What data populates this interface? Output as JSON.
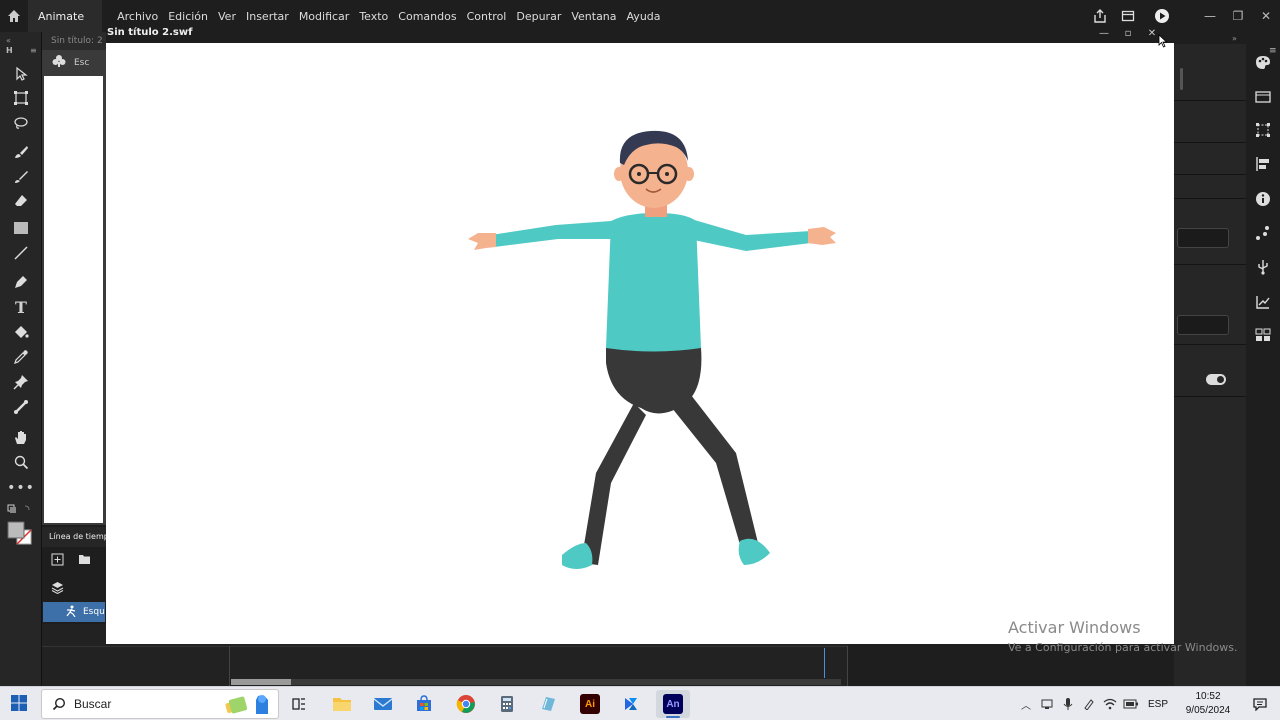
{
  "app": {
    "workspace": "Animate",
    "menu": [
      "Archivo",
      "Edición",
      "Ver",
      "Insertar",
      "Modificar",
      "Texto",
      "Comandos",
      "Control",
      "Depurar",
      "Ventana",
      "Ayuda"
    ]
  },
  "document": {
    "tab_title": "Sin título: 2",
    "scene_label": "Esc",
    "timeline_label": "Línea de tiemp",
    "layer_name": "Esqu"
  },
  "swf_window": {
    "title": "Sin título 2.swf"
  },
  "tools": [
    "selection-tool",
    "free-transform-tool",
    "lasso-tool",
    "paint-brush-tool",
    "brush-tool",
    "eraser-tool",
    "rectangle-tool",
    "line-tool",
    "pen-tool",
    "text-tool",
    "paint-bucket-tool",
    "eyedropper-tool",
    "pin-tool",
    "bone-tool",
    "hand-tool",
    "zoom-tool",
    "more-tools"
  ],
  "tool_text_glyph": "T",
  "watermark": {
    "line1": "Activar Windows",
    "line2": "Ve a Configuración para activar Windows."
  },
  "taskbar": {
    "search_placeholder": "Buscar",
    "apps": [
      "task-view",
      "file-explorer",
      "mail",
      "microsoft-store",
      "chrome",
      "calculator",
      "notepad",
      "illustrator",
      "power-automate",
      "animate"
    ],
    "illustrator_label": "Ai",
    "animate_label": "An",
    "language": "ESP",
    "time": "10:52",
    "date": "9/05/2024"
  },
  "colors": {
    "accent_blue": "#3d6fa8",
    "shirt": "#4ec9c4",
    "pants": "#383838",
    "skin": "#f5b28e",
    "hair": "#343a52"
  }
}
